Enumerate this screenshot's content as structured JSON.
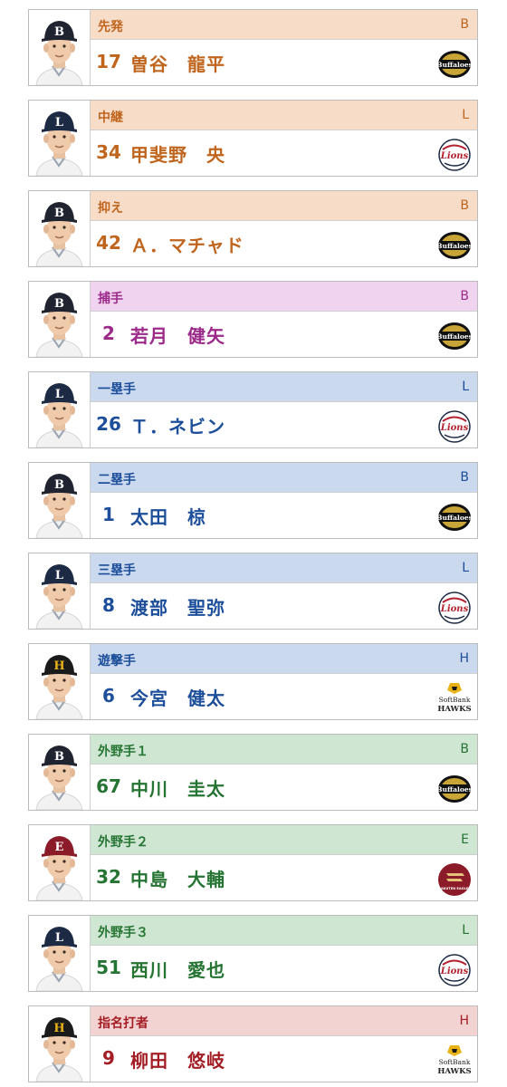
{
  "players": [
    {
      "position": "先発",
      "team": "B",
      "number": "17",
      "name": "曽谷　龍平",
      "theme": "p",
      "cap": "buffaloes-cap",
      "logo": "buffaloes-logo"
    },
    {
      "position": "中継",
      "team": "L",
      "number": "34",
      "name": "甲斐野　央",
      "theme": "p",
      "cap": "lions-cap",
      "logo": "lions-logo"
    },
    {
      "position": "抑え",
      "team": "B",
      "number": "42",
      "name": "Ａ．マチャド",
      "theme": "p",
      "cap": "buffaloes-cap",
      "logo": "buffaloes-logo"
    },
    {
      "position": "捕手",
      "team": "B",
      "number": "2",
      "name": "若月　健矢",
      "theme": "c",
      "cap": "buffaloes-cap",
      "logo": "buffaloes-logo"
    },
    {
      "position": "一塁手",
      "team": "L",
      "number": "26",
      "name": "Ｔ．ネビン",
      "theme": "i",
      "cap": "lions-cap",
      "logo": "lions-logo"
    },
    {
      "position": "二塁手",
      "team": "B",
      "number": "1",
      "name": "太田　椋",
      "theme": "i",
      "cap": "buffaloes-cap",
      "logo": "buffaloes-logo"
    },
    {
      "position": "三塁手",
      "team": "L",
      "number": "8",
      "name": "渡部　聖弥",
      "theme": "i",
      "cap": "lions-cap",
      "logo": "lions-logo"
    },
    {
      "position": "遊撃手",
      "team": "H",
      "number": "6",
      "name": "今宮　健太",
      "theme": "i",
      "cap": "hawks-cap",
      "logo": "hawks-logo"
    },
    {
      "position": "外野手１",
      "team": "B",
      "number": "67",
      "name": "中川　圭太",
      "theme": "o",
      "cap": "buffaloes-cap",
      "logo": "buffaloes-logo"
    },
    {
      "position": "外野手２",
      "team": "E",
      "number": "32",
      "name": "中島　大輔",
      "theme": "o",
      "cap": "eagles-cap",
      "logo": "eagles-logo"
    },
    {
      "position": "外野手３",
      "team": "L",
      "number": "51",
      "name": "西川　愛也",
      "theme": "o",
      "cap": "lions-cap",
      "logo": "lions-logo"
    },
    {
      "position": "指名打者",
      "team": "H",
      "number": "9",
      "name": "柳田　悠岐",
      "theme": "d",
      "cap": "hawks-cap",
      "logo": "hawks-logo"
    }
  ],
  "logo_text": {
    "buffaloes": "Buffaloes",
    "lions": "Lions",
    "eagles": "RAKUTEN EAGLES",
    "hawks_top": "SoftBank",
    "hawks_bottom": "HAWKS"
  },
  "colors": {
    "buffaloes_cap": "#1f2430",
    "lions_cap": "#1d2a44",
    "hawks_cap": "#1a1a1a",
    "eagles_cap": "#8c1b2a",
    "hawks_gold": "#e9b317",
    "eagles_red": "#8c1b2a",
    "lions_red": "#b3202f"
  }
}
